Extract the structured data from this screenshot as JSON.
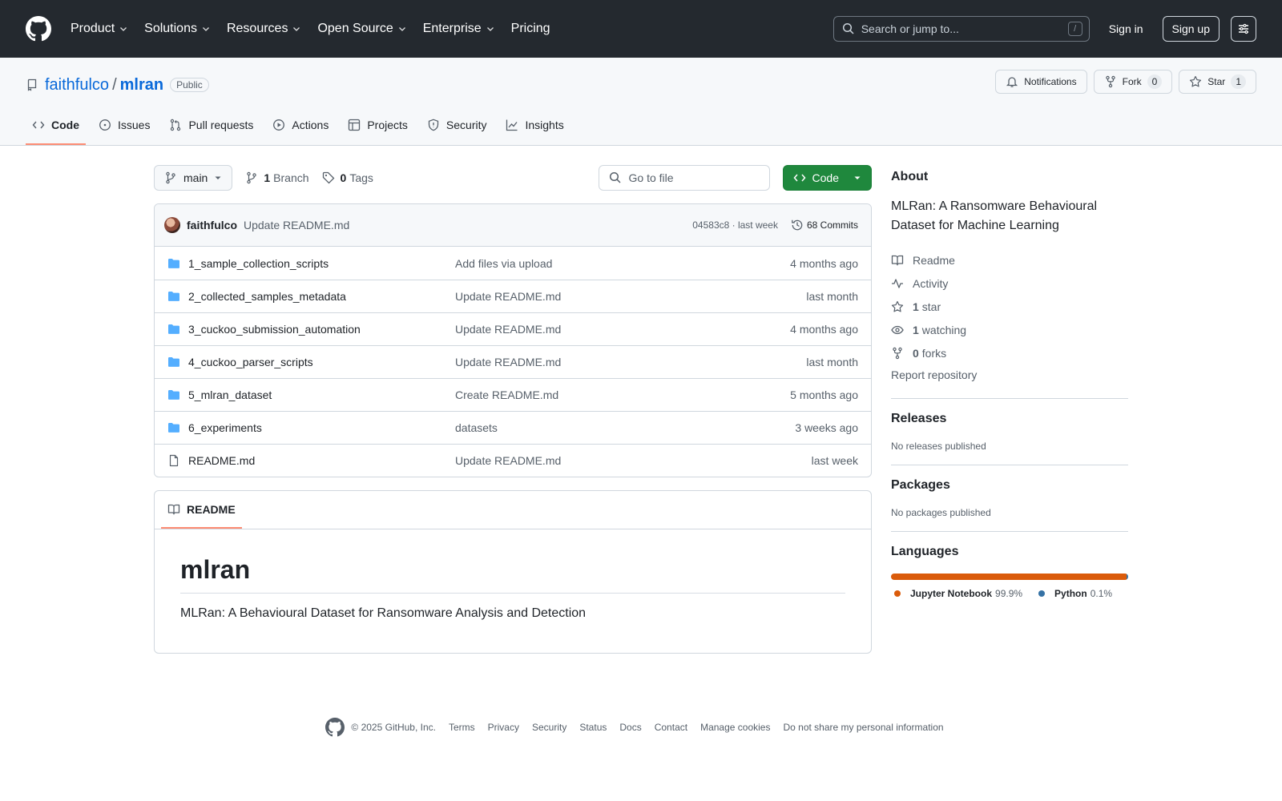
{
  "header": {
    "nav": [
      "Product",
      "Solutions",
      "Resources",
      "Open Source",
      "Enterprise",
      "Pricing"
    ],
    "search_placeholder": "Search or jump to...",
    "search_shortcut": "/",
    "signin": "Sign in",
    "signup": "Sign up"
  },
  "repo": {
    "owner": "faithfulco",
    "separator": "/",
    "name": "mlran",
    "visibility": "Public",
    "notifications": "Notifications",
    "fork_label": "Fork",
    "fork_count": "0",
    "star_label": "Star",
    "star_count": "1",
    "tabs": [
      "Code",
      "Issues",
      "Pull requests",
      "Actions",
      "Projects",
      "Security",
      "Insights"
    ]
  },
  "filebar": {
    "branch": "main",
    "branch_count": "1",
    "branch_label": "Branch",
    "tag_count": "0",
    "tag_label": "Tags",
    "goto_placeholder": "Go to file",
    "code_button": "Code"
  },
  "commit": {
    "author": "faithfulco",
    "message": "Update README.md",
    "hash_time": "04583c8 · last week",
    "commits": "68 Commits"
  },
  "files": [
    {
      "type": "dir",
      "name": "1_sample_collection_scripts",
      "message": "Add files via upload",
      "date": "4 months ago"
    },
    {
      "type": "dir",
      "name": "2_collected_samples_metadata",
      "message": "Update README.md",
      "date": "last month"
    },
    {
      "type": "dir",
      "name": "3_cuckoo_submission_automation",
      "message": "Update README.md",
      "date": "4 months ago"
    },
    {
      "type": "dir",
      "name": "4_cuckoo_parser_scripts",
      "message": "Update README.md",
      "date": "last month"
    },
    {
      "type": "dir",
      "name": "5_mlran_dataset",
      "message": "Create README.md",
      "date": "5 months ago"
    },
    {
      "type": "dir",
      "name": "6_experiments",
      "message": "datasets",
      "date": "3 weeks ago"
    },
    {
      "type": "file",
      "name": "README.md",
      "message": "Update README.md",
      "date": "last week"
    }
  ],
  "readme": {
    "tab": "README",
    "title": "mlran",
    "body": "MLRan: A Behavioural Dataset for Ransomware Analysis and Detection"
  },
  "about": {
    "heading": "About",
    "description": "MLRan: A Ransomware Behavioural Dataset for Machine Learning",
    "readme": "Readme",
    "activity": "Activity",
    "stars_count": "1",
    "stars_label": "star",
    "watching_count": "1",
    "watching_label": "watching",
    "forks_count": "0",
    "forks_label": "forks",
    "report": "Report repository"
  },
  "releases": {
    "heading": "Releases",
    "text": "No releases published"
  },
  "packages": {
    "heading": "Packages",
    "text": "No packages published"
  },
  "languages": {
    "heading": "Languages",
    "items": [
      {
        "name": "Jupyter Notebook",
        "percent": "99.9%",
        "value": 99.9,
        "color": "#DA5B0B"
      },
      {
        "name": "Python",
        "percent": "0.1%",
        "value": 0.1,
        "color": "#3572A5"
      }
    ]
  },
  "footer": {
    "copyright": "© 2025 GitHub, Inc.",
    "links": [
      "Terms",
      "Privacy",
      "Security",
      "Status",
      "Docs",
      "Contact",
      "Manage cookies",
      "Do not share my personal information"
    ]
  },
  "colors": {
    "accent": "#0969da",
    "header_bg": "#24292f",
    "code_button": "#1f883d",
    "tab_underline": "#fd8c73",
    "folder": "#54aeff"
  }
}
